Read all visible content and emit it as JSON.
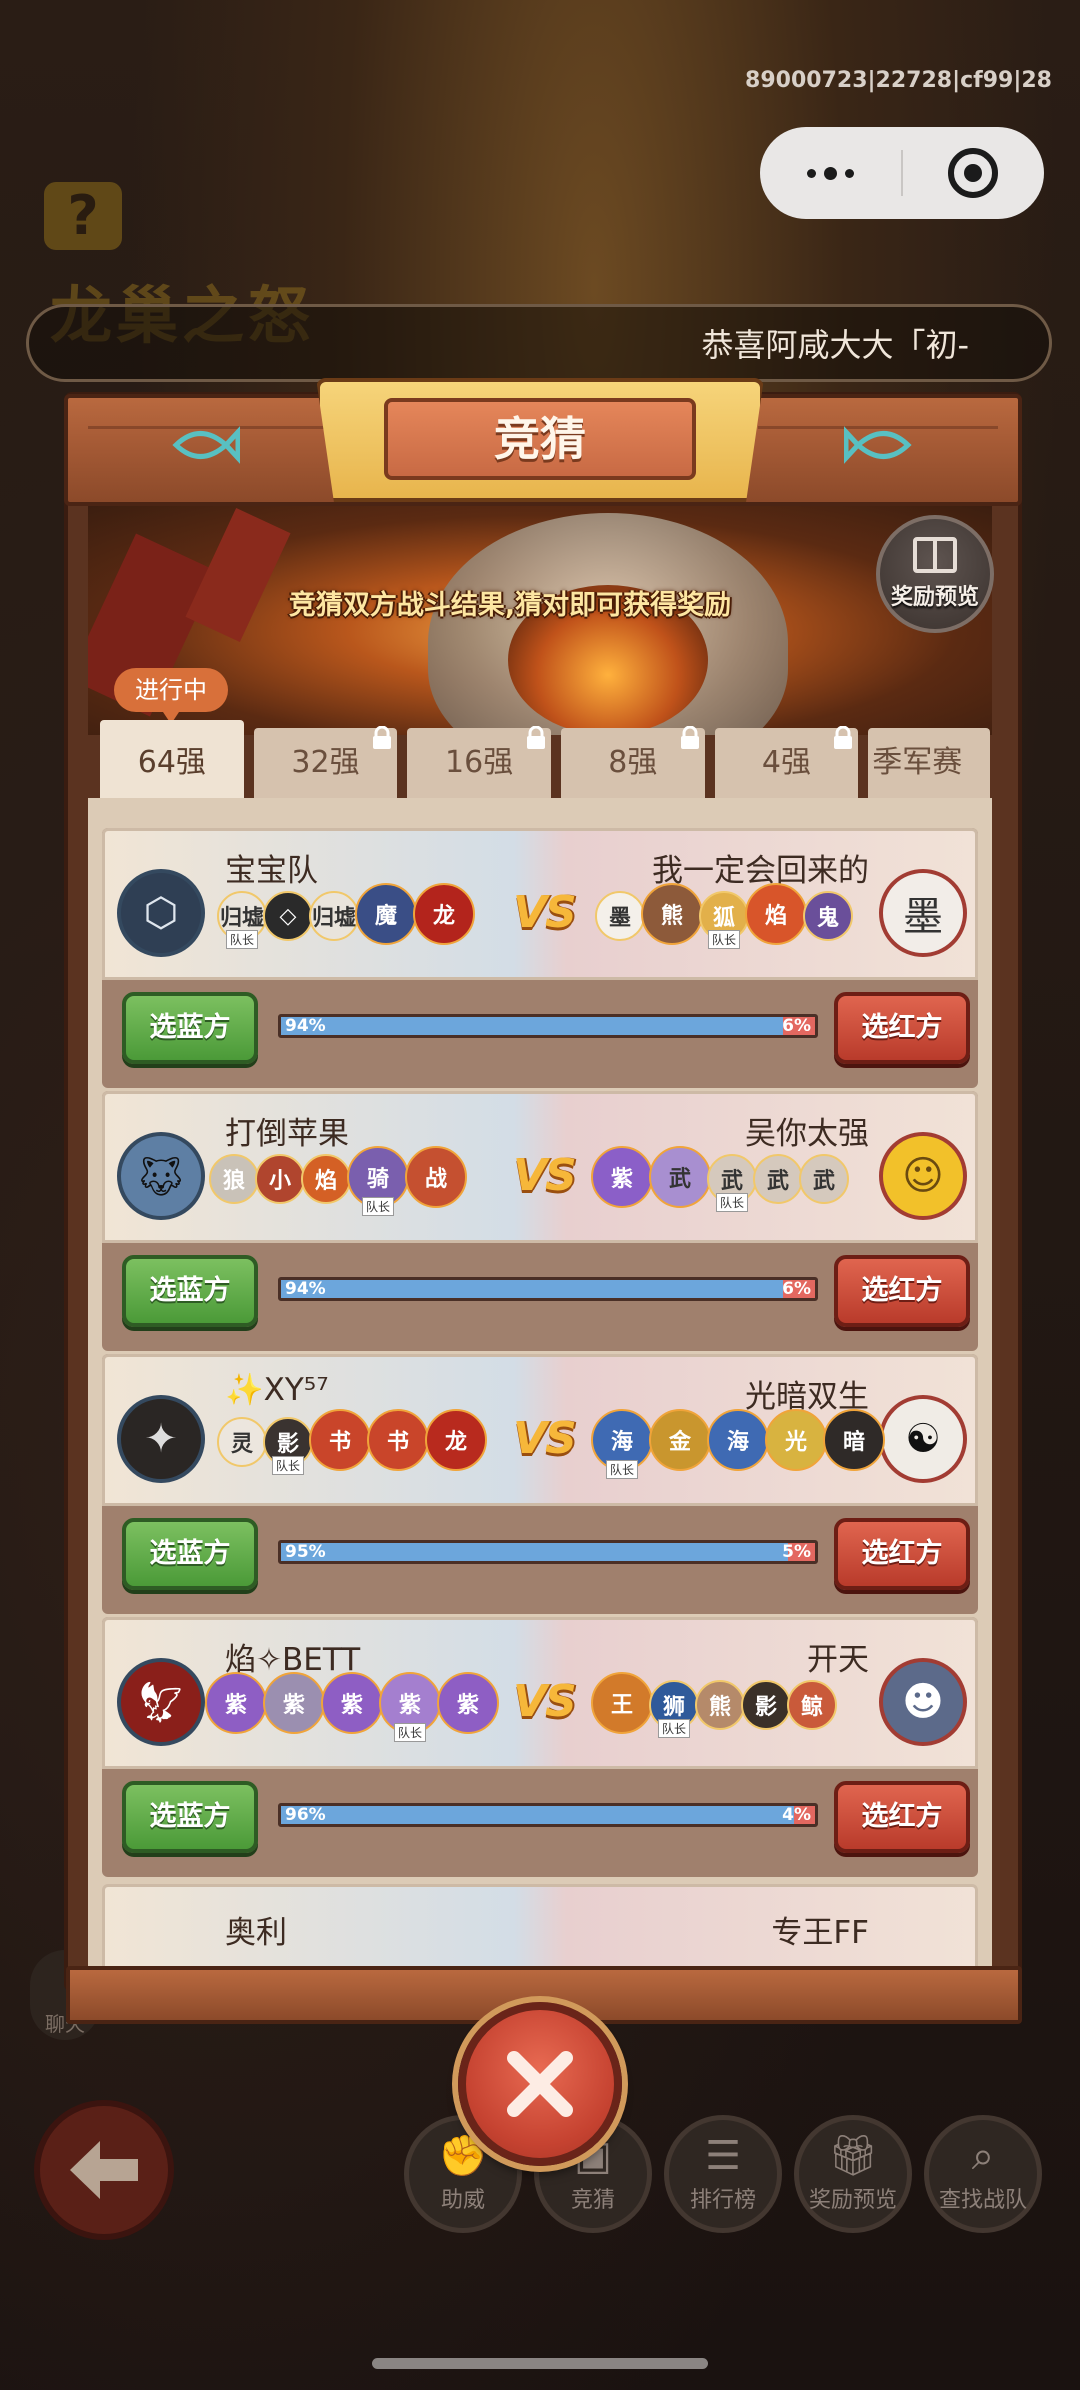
{
  "system": {
    "debug_id": "89000723|22728|cf99|28",
    "capsule_more_icon": "more-dots-icon",
    "capsule_close_icon": "target-circle-icon"
  },
  "background": {
    "title": "龙巢之怒",
    "help_label": "?",
    "marquee": "恭喜阿咸大大「初-"
  },
  "modal": {
    "title": "竞猜",
    "caption": "竞猜双方战斗结果,猜对即可获得奖励",
    "reward_preview": "奖励预览",
    "status": "进行中",
    "tabs": [
      {
        "label": "64强",
        "locked": false
      },
      {
        "label": "32强",
        "locked": true
      },
      {
        "label": "16强",
        "locked": true
      },
      {
        "label": "8强",
        "locked": true
      },
      {
        "label": "4强",
        "locked": true
      },
      {
        "label": "季军赛",
        "locked": false
      }
    ],
    "matches": [
      {
        "blue_name": "宝宝队",
        "red_name": "我一定会回来的",
        "vs": "VS",
        "blue_pct": "94%",
        "red_pct": "6%",
        "blue_ratio": 0.94,
        "pick_blue": "选蓝方",
        "pick_red": "选红方",
        "blue_heroes": [
          "归墟",
          "◇",
          "归墟",
          "魔",
          "龙"
        ],
        "red_heroes": [
          "墨",
          "熊",
          "狐",
          "焰",
          "鬼"
        ],
        "captain_tag": "队长"
      },
      {
        "blue_name": "打倒苹果",
        "red_name": "吴你太强",
        "vs": "VS",
        "blue_pct": "94%",
        "red_pct": "6%",
        "blue_ratio": 0.94,
        "pick_blue": "选蓝方",
        "pick_red": "选红方",
        "blue_heroes": [
          "狼",
          "小",
          "焰",
          "骑",
          "战"
        ],
        "red_heroes": [
          "紫",
          "武",
          "武",
          "武",
          "武"
        ],
        "captain_tag": "队长"
      },
      {
        "blue_name": "✨XY⁵⁷",
        "red_name": "光暗双生",
        "vs": "VS",
        "blue_pct": "95%",
        "red_pct": "5%",
        "blue_ratio": 0.95,
        "pick_blue": "选蓝方",
        "pick_red": "选红方",
        "blue_heroes": [
          "灵",
          "影",
          "书",
          "书",
          "龙"
        ],
        "red_heroes": [
          "海",
          "金",
          "海",
          "光",
          "暗"
        ],
        "captain_tag": "队长"
      },
      {
        "blue_name": "焰✧BETT",
        "red_name": "开天",
        "vs": "VS",
        "blue_pct": "96%",
        "red_pct": "4%",
        "blue_ratio": 0.96,
        "pick_blue": "选蓝方",
        "pick_red": "选红方",
        "blue_heroes": [
          "紫",
          "紫",
          "紫",
          "紫",
          "紫"
        ],
        "red_heroes": [
          "王",
          "狮",
          "熊",
          "影",
          "鲸"
        ],
        "captain_tag": "队长"
      }
    ],
    "partial_match": {
      "blue_name": "奥利",
      "red_name": "专王FF"
    }
  },
  "bottom_nav": {
    "back_icon": "back-arrow-icon",
    "side_chip": "聊天",
    "items": [
      {
        "label": "助威",
        "icon": "fist-icon"
      },
      {
        "label": "竞猜",
        "icon": "ticket-icon"
      },
      {
        "label": "排行榜",
        "icon": "list-icon"
      },
      {
        "label": "奖励预览",
        "icon": "gift-icon"
      },
      {
        "label": "查找战队",
        "icon": "search-icon"
      }
    ]
  },
  "colors": {
    "blue_button": "#4b9a38",
    "red_button": "#b93b2b",
    "odds_blue": "#6ca6dc",
    "odds_red": "#e36860",
    "panel_wood": "#a55a35"
  }
}
